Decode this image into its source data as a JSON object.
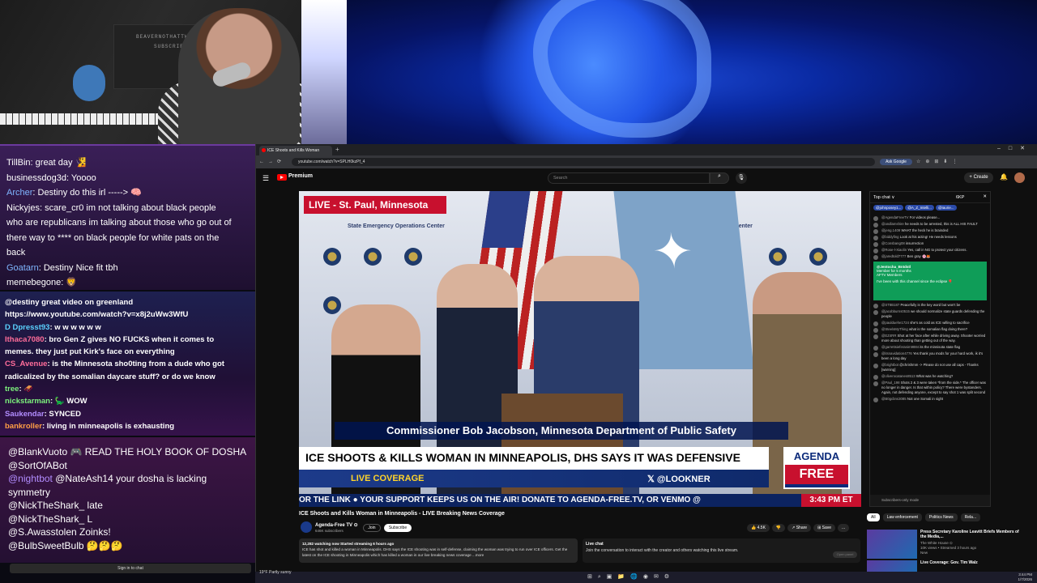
{
  "overlay_chat_top": [
    {
      "user": "TillBin",
      "text": ": great day 🧏",
      "color": "white"
    },
    {
      "user": "businessdog3d",
      "text": ": Yoooo",
      "color": "white"
    },
    {
      "user": "Archer",
      "text": ": Destiny do this irl -----> 🧠",
      "color": "blue"
    },
    {
      "user": "Nickyjes",
      "text": ": scare_cr0 im not talking about black people",
      "color": "white"
    },
    {
      "user": "",
      "text": "who are republicans im talking about those who go out of",
      "color": "white"
    },
    {
      "user": "",
      "text": "there way to **** on black people for white pats on the",
      "color": "white"
    },
    {
      "user": "",
      "text": "back",
      "color": "white"
    },
    {
      "user": "Goatarn",
      "text": ": Destiny Nice fit tbh",
      "color": "blue"
    },
    {
      "user": "memebegone",
      "text": ": 🦁",
      "color": "white"
    }
  ],
  "overlay_chat_mid": [
    {
      "user": "",
      "text": "@destiny great video on greenland",
      "color": "white"
    },
    {
      "user": "",
      "text": "https://www.youtube.com/watch?v=x8j2uWw3WfU",
      "color": "white"
    },
    {
      "user": "D Dpresst93",
      "text": ": w w w w w w",
      "color": "cyan"
    },
    {
      "user": "Ithaca7080",
      "text": ": bro Gen Z gives NO FUCKS when it comes to",
      "color": "pink"
    },
    {
      "user": "",
      "text": "memes. they just put Kirk's face on everything",
      "color": "white"
    },
    {
      "user": "CS_Avenue",
      "text": ": is the Minnesota sho0ting from a dude who got",
      "color": "pink"
    },
    {
      "user": "",
      "text": "radicalized by the somalian daycare stuff? or do we know",
      "color": "white"
    },
    {
      "user": "tree",
      "text": ": 🛷",
      "color": "green"
    },
    {
      "user": "nickstarman",
      "text": ": 🦕 WOW",
      "color": "green"
    },
    {
      "user": "Saukendar",
      "text": ": SYNCED",
      "color": "purple"
    },
    {
      "user": "bankroller",
      "text": ": living in minneapolis is exhausting",
      "color": "orange"
    }
  ],
  "overlay_chat_bottom": [
    {
      "user": "@BlankVuoto",
      "text": " 🎮 READ THE HOLY BOOK OF DOSHA",
      "color": "white"
    },
    {
      "user": "@SortOfABot",
      "text": "",
      "color": "white"
    },
    {
      "user": "@nightbot",
      "text": " @NateAsh14 your dosha is lacking",
      "color": "purple"
    },
    {
      "user": "",
      "text": "symmetry",
      "color": "white"
    },
    {
      "user": "@NickTheShark_",
      "text": " late",
      "color": "white"
    },
    {
      "user": "@NickTheShark_",
      "text": " L",
      "color": "white"
    },
    {
      "user": "@S.Awasstolen",
      "text": " Zoinks!",
      "color": "white"
    },
    {
      "user": "@BulbSweetBulb",
      "text": " 🤔🤔🤔",
      "color": "white"
    }
  ],
  "signin_label": "Sign in to chat",
  "weather": {
    "temp": "19°F",
    "desc": "Partly sunny"
  },
  "browser": {
    "tab_title": "ICE Shoots and Kills Woman",
    "url": "youtube.com/watch?v=SPLH0kzPf_4",
    "ask_google": "Ask Google"
  },
  "youtube": {
    "brand": "Premium",
    "search_placeholder": "Search",
    "create_label": "+ Create",
    "video": {
      "live_label": "LIVE - St. Paul, Minnesota",
      "name_bar": "Commissioner Bob Jacobson, Minnesota Department of Public Safety",
      "headline": "ICE SHOOTS & KILLS WOMAN IN MINNEAPOLIS, DHS SAYS IT WAS DEFENSIVE",
      "sub_headline": "LIVE COVERAGE",
      "credit": "𝕏 @LOOKNER",
      "brand_top": "AGENDA",
      "brand_bottom": "FREE",
      "ticker": "OR THE LINK ● YOUR SUPPORT KEEPS US ON THE AIR! DONATE TO AGENDA-FREE.TV, OR VENMO @",
      "clock": "3:43 PM ET",
      "backdrop_text": "State Emergency Operations Center"
    },
    "title": "ICE Shoots and Kills Woman in Minneapolis - LIVE Breaking News Coverage",
    "channel": "Agenda-Free TV ⊙",
    "subscribers": "646K subscribers",
    "join": "Join",
    "subscribe": "Subscribe",
    "likes": "👍 4.5K",
    "dislike": "👎",
    "share": "↗ Share",
    "save": "⊞ Save",
    "more": "...",
    "desc_meta": "12,282 watching now  Started streaming 6 hours ago",
    "desc_text": "ICE has shot and killed a woman in Minneapolis. DHS says the ICE shooting was in self-defense, claiming the woman was trying to run over ICE officers. Get the latest on the ICE shooting in Minneapolis which has killed a woman in our live breaking news coverage ...more",
    "live_chat_title": "Live chat",
    "live_chat_text": "Join the conversation to interact with the creator and others watching this live stream.",
    "open_panel": "Open panel"
  },
  "ytchat": {
    "header": "Top chat ∨",
    "members_count": "6KP",
    "pinned": [
      "@johnposey1...",
      "@A_Z_Intelli...",
      "@Iaurie..."
    ],
    "rows": [
      {
        "user": "@AgendaFreeTV",
        "text": "For videos please..."
      },
      {
        "user": "@andlamshire",
        "text": "he needs to be arrested, this is ALL HIS FAULT"
      },
      {
        "user": "@jeng.1409",
        "text": "WHAT the heck he is brainded"
      },
      {
        "user": "@biddyfing",
        "text": "Look at his acting! He needs lessons"
      },
      {
        "user": "@Consbang08",
        "text": "insurrection"
      },
      {
        "user": "@Rose-l-Xiaolin",
        "text": "Yes, call in NG to protect your citizens."
      },
      {
        "user": "@jaredtold7777",
        "text": "Ben gray 🌸🦊"
      },
      {
        "user": "@ST8B187",
        "text": "Peacefully is the key word but won't be"
      },
      {
        "user": "@jacobburns0515",
        "text": "we should normalize state guards defending the people"
      },
      {
        "user": "@paulduehe1724",
        "text": "she's as cold as ICE willing to sacrifice"
      },
      {
        "user": "@SteelsMyThing",
        "text": "what is the somalian flag doing there?"
      },
      {
        "user": "@EZ4RR",
        "text": "Shot at her face after while driving away. Shooter worried more about shooting than getting out of the way."
      },
      {
        "user": "@garrettsieferanim9884",
        "text": "its the minnisota state flag"
      },
      {
        "user": "@itsnavidation4776",
        "text": "Yes thank you mods for your hard work, ik it's been a long day"
      },
      {
        "user": "@brightbot",
        "text": "@chrishmm -> Please do not use all caps - Thanks [warning]"
      },
      {
        "user": "@oliverocatanes8513",
        "text": "What was he watching?"
      },
      {
        "user": "@Paul_198",
        "text": "Shots 2 & 3 were taken *from the side.* The officer was no longer in danger. Is that within policy? There were bystanders. Again, not defending anyone, except to say shot 1 was split second"
      },
      {
        "user": "@B0gcbns3085",
        "text": "Not one Somali in sight"
      }
    ],
    "member_name": "@Jentocha_Bntdstl",
    "member_line": "Member for 5 months",
    "member_tag": "AFTV Members",
    "member_msg": "I've been with this channel since the eclipse 🎈",
    "footer": "Subscribers-only mode"
  },
  "related": {
    "chips": [
      "All",
      "Law enforcement",
      "Politics News",
      "Rela..."
    ],
    "items": [
      {
        "title": "Press Secretary Karoline Leavitt Briefs Members of the Media,...",
        "meta": "The White House ⊙\n10K views • Streamed 3 hours ago\nNew"
      },
      {
        "title": "Live Coverage: Gov. Tim Walz",
        "meta": ""
      }
    ]
  },
  "taskbar": {
    "time": "3:44 PM",
    "date": "1/7/2026"
  }
}
